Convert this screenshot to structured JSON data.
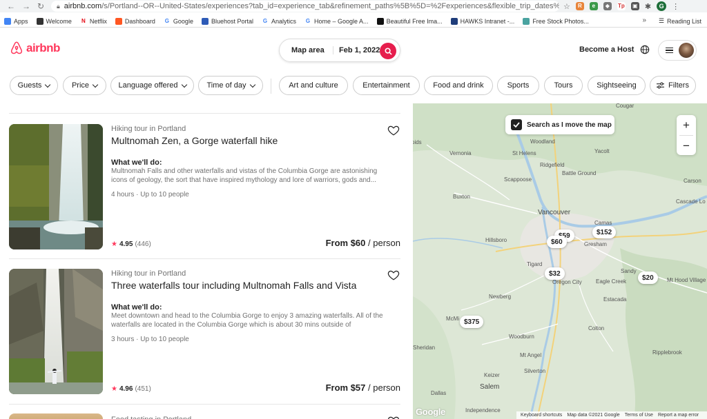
{
  "browser": {
    "url_host": "airbnb.com",
    "url_rest": "/s/Portland--OR--United-States/experiences?tab_id=experience_tab&refinement_paths%5B%5D=%2Fexperiences&flexible_trip_dates%5...",
    "profile_initial": "G",
    "bookmarks": [
      {
        "label": "Apps",
        "icon": "apps-grid-icon",
        "color": "#4285f4"
      },
      {
        "label": "Welcome",
        "icon": "globe-icon",
        "color": "#333333"
      },
      {
        "label": "Netflix",
        "icon": "netflix-icon",
        "color": "#e50914",
        "glyph": "N"
      },
      {
        "label": "Dashboard",
        "icon": "dashboard-icon",
        "color": "#ff5722"
      },
      {
        "label": "Google",
        "icon": "google-icon",
        "color": "#4285f4",
        "glyph": "G"
      },
      {
        "label": "Bluehost Portal",
        "icon": "bluehost-icon",
        "color": "#2e5bb7"
      },
      {
        "label": "Analytics",
        "icon": "google-icon",
        "color": "#4285f4",
        "glyph": "G"
      },
      {
        "label": "Home – Google A...",
        "icon": "google-icon",
        "color": "#4285f4",
        "glyph": "G"
      },
      {
        "label": "Beautiful Free Ima...",
        "icon": "unsplash-icon",
        "color": "#111111"
      },
      {
        "label": "HAWKS Intranet -...",
        "icon": "hawks-icon",
        "color": "#1f3d7a"
      },
      {
        "label": "Free Stock Photos...",
        "icon": "stock-photos-icon",
        "color": "#4aa3a0"
      }
    ],
    "bookmarks_more": "»",
    "reading_list": "Reading List"
  },
  "header": {
    "logo_text": "airbnb",
    "search_location": "Map area",
    "search_date": "Feb 1, 2022",
    "become_host": "Become a Host",
    "brand_color": "#ff385c"
  },
  "filters": {
    "dropdowns": [
      "Guests",
      "Price",
      "Language offered",
      "Time of day"
    ],
    "categories": [
      "Art and culture",
      "Entertainment",
      "Food and drink",
      "Sports",
      "Tours",
      "Sightseeing"
    ],
    "filters_label": "Filters"
  },
  "listings": [
    {
      "kind": "Hiking tour in Portland",
      "title": "Multnomah Zen, a Gorge waterfall hike",
      "what_label": "What we'll do:",
      "description": "Multnomah Falls and other waterfalls and vistas of the Columbia Gorge are astonishing icons of geology, the sort that have inspired mythology and lore of warriors, gods and...",
      "meta": "4 hours · Up to 10 people",
      "rating": "4.95",
      "reviews": "(446)",
      "price_prefix": "From $60",
      "price_suffix": " / person"
    },
    {
      "kind": "Hiking tour in Portland",
      "title": "Three waterfalls tour including Multnomah Falls and Vista",
      "what_label": "What we'll do:",
      "description": "Meet downtown and head to the Columbia Gorge to enjoy 3 amazing waterfalls. All of the waterfalls are located in the Columbia Gorge which is about 30 mins outside of Portland....",
      "meta": "3 hours · Up to 10 people",
      "rating": "4.96",
      "reviews": "(451)",
      "price_prefix": "From $57",
      "price_suffix": " / person"
    },
    {
      "kind": "Food tasting in Portland"
    }
  ],
  "map": {
    "search_toggle_label": "Search as I move the map",
    "zoom_in": "+",
    "zoom_out": "−",
    "labels": {
      "vernonia": "Vernonia",
      "st_helens": "St Helens",
      "woodland": "Woodland",
      "yacolt": "Yacolt",
      "ridgefield": "Ridgefield",
      "battle_ground": "Battle Ground",
      "scappoose": "Scappoose",
      "buxton": "Buxton",
      "vancouver": "Vancouver",
      "camas": "Camas",
      "hillsboro": "Hillsboro",
      "gresham": "Gresham",
      "tigard": "Tigard",
      "oregon_city": "Oregon City",
      "sandy": "Sandy",
      "eagle_creek": "Eagle Creek",
      "mt_hood_village": "Mt Hood Village",
      "estacada": "Estacada",
      "newberg": "Newberg",
      "mcminnville": "McMi",
      "colton": "Colton",
      "woodburn": "Woodburn",
      "mt_angel": "Mt Angel",
      "silverton": "Silverton",
      "ripplebrook": "Ripplebrook",
      "sheridan": "Sheridan",
      "keizer": "Keizer",
      "salem": "Salem",
      "dallas": "Dallas",
      "independence": "Independence",
      "cougar": "Cougar",
      "carson": "Carson",
      "cascade_locks": "Cascade Lo",
      "pids": "pids"
    },
    "pins": [
      "$59",
      "$60",
      "$152",
      "$32",
      "$20",
      "$375"
    ],
    "google_mark": "Google",
    "footer": [
      "Keyboard shortcuts",
      "Map data ©2021 Google",
      "Terms of Use",
      "Report a map error"
    ]
  }
}
